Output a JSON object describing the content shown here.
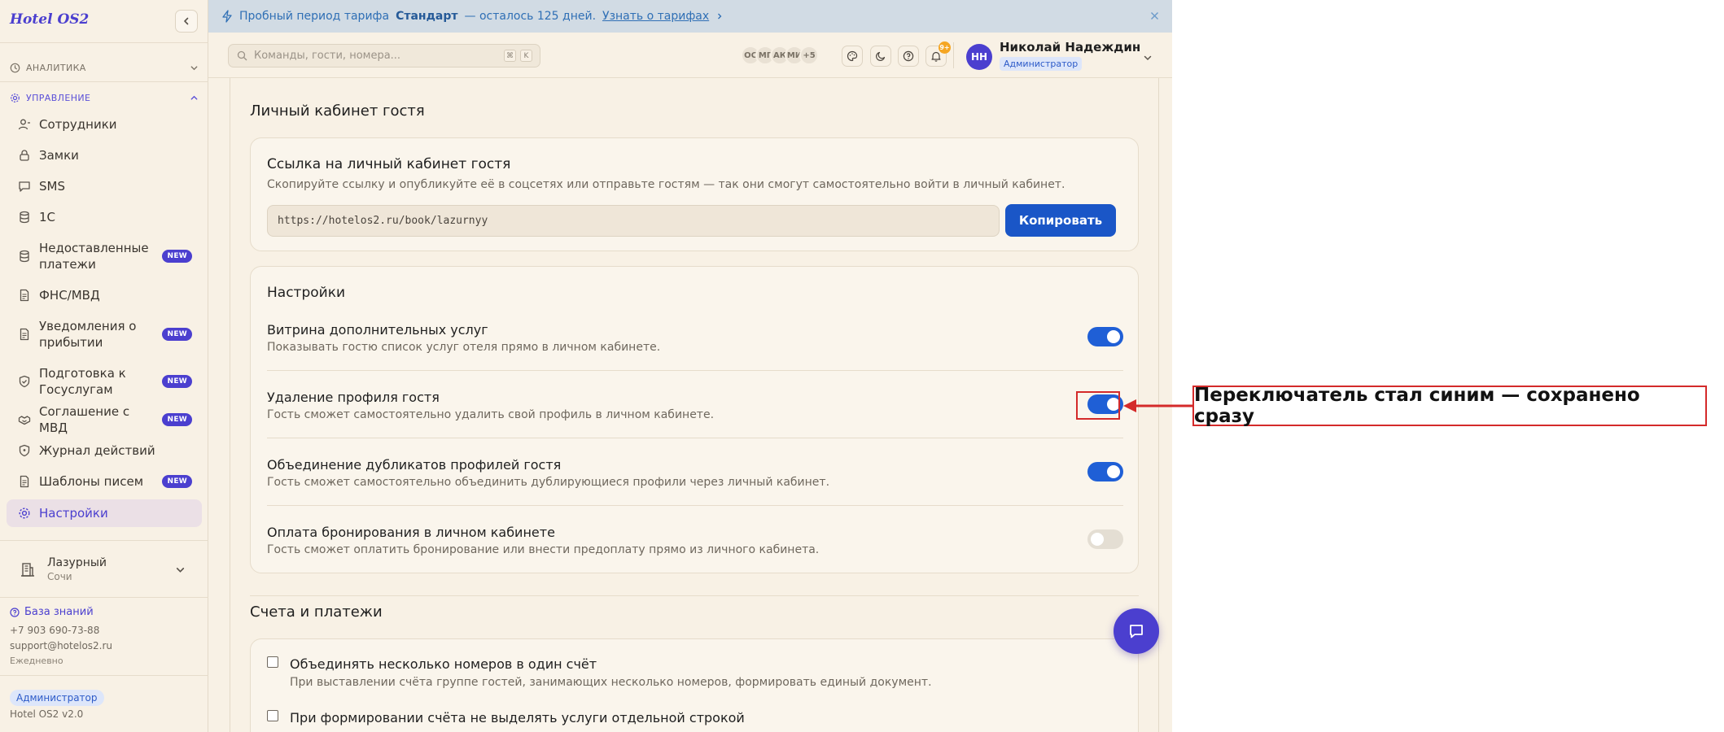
{
  "app": {
    "brand": "Hotel OS2"
  },
  "banner": {
    "text_prefix": "Пробный период тарифа",
    "plan": "Стандарт",
    "text_suffix": "— осталось 125 дней.",
    "link": "Узнать о тарифах"
  },
  "sidebar": {
    "sections": {
      "analytics": "АНАЛИТИКА",
      "manage": "УПРАВЛЕНИЕ"
    },
    "items": [
      {
        "label": "Сотрудники",
        "badge": ""
      },
      {
        "label": "Замки",
        "badge": ""
      },
      {
        "label": "SMS",
        "badge": ""
      },
      {
        "label": "1С",
        "badge": ""
      },
      {
        "label": "Недоставленные платежи",
        "badge": "NEW"
      },
      {
        "label": "ФНС/МВД",
        "badge": ""
      },
      {
        "label": "Уведомления о прибытии",
        "badge": "NEW"
      },
      {
        "label": "Подготовка к Госуслугам",
        "badge": "NEW"
      },
      {
        "label": "Соглашение с МВД",
        "badge": "NEW"
      },
      {
        "label": "Журнал действий",
        "badge": ""
      },
      {
        "label": "Шаблоны писем",
        "badge": "NEW"
      },
      {
        "label": "Настройки",
        "badge": ""
      }
    ],
    "hotel": {
      "name": "Лазурный",
      "city": "Сочи"
    },
    "knowledge_base": "База знаний",
    "phone": "+7 903 690-73-88",
    "email": "support@hotelos2.ru",
    "schedule": "Ежедневно",
    "role": "Администратор",
    "version": "Hotel OS2 v2.0"
  },
  "header": {
    "search_placeholder": "Команды, гости, номера...",
    "shortcut": [
      "⌘",
      "K"
    ],
    "avatars": [
      "ОС",
      "МГ",
      "АК",
      "МИ",
      "+5"
    ],
    "notifications_count": "9+",
    "user": {
      "initials": "НН",
      "name": "Николай Надеждин",
      "role": "Администратор"
    }
  },
  "main": {
    "section_title": "Личный кабинет гостя",
    "link_card": {
      "title": "Ссылка на личный кабинет гостя",
      "description": "Скопируйте ссылку и опубликуйте её в соцсетях или отправьте гостям — так они смогут самостоятельно войти в личный кабинет.",
      "url": "https://hotelos2.ru/book/lazurnyy",
      "copy_label": "Копировать"
    },
    "settings_card": {
      "title": "Настройки",
      "rows": [
        {
          "title": "Витрина дополнительных услуг",
          "desc": "Показывать гостю список услуг отеля прямо в личном кабинете.",
          "enabled": true
        },
        {
          "title": "Удаление профиля гостя",
          "desc": "Гость сможет самостоятельно удалить свой профиль в личном кабинете.",
          "enabled": true
        },
        {
          "title": "Объединение дубликатов профилей гостя",
          "desc": "Гость сможет самостоятельно объединить дублирующиеся профили через личный кабинет.",
          "enabled": true
        },
        {
          "title": "Оплата бронирования в личном кабинете",
          "desc": "Гость сможет оплатить бронирование или внести предоплату прямо из личного кабинета.",
          "enabled": false
        }
      ]
    },
    "billing": {
      "title": "Счета и платежи",
      "options": [
        {
          "title": "Объединять несколько номеров в один счёт",
          "desc": "При выставлении счёта группе гостей, занимающих несколько номеров, формировать единый документ.",
          "checked": false
        },
        {
          "title": "При формировании счёта не выделять услуги отдельной строкой",
          "desc": "",
          "checked": false
        }
      ]
    }
  },
  "annotation": {
    "text": "Переключатель стал синим — сохранено сразу",
    "color": "#d42a2a"
  }
}
